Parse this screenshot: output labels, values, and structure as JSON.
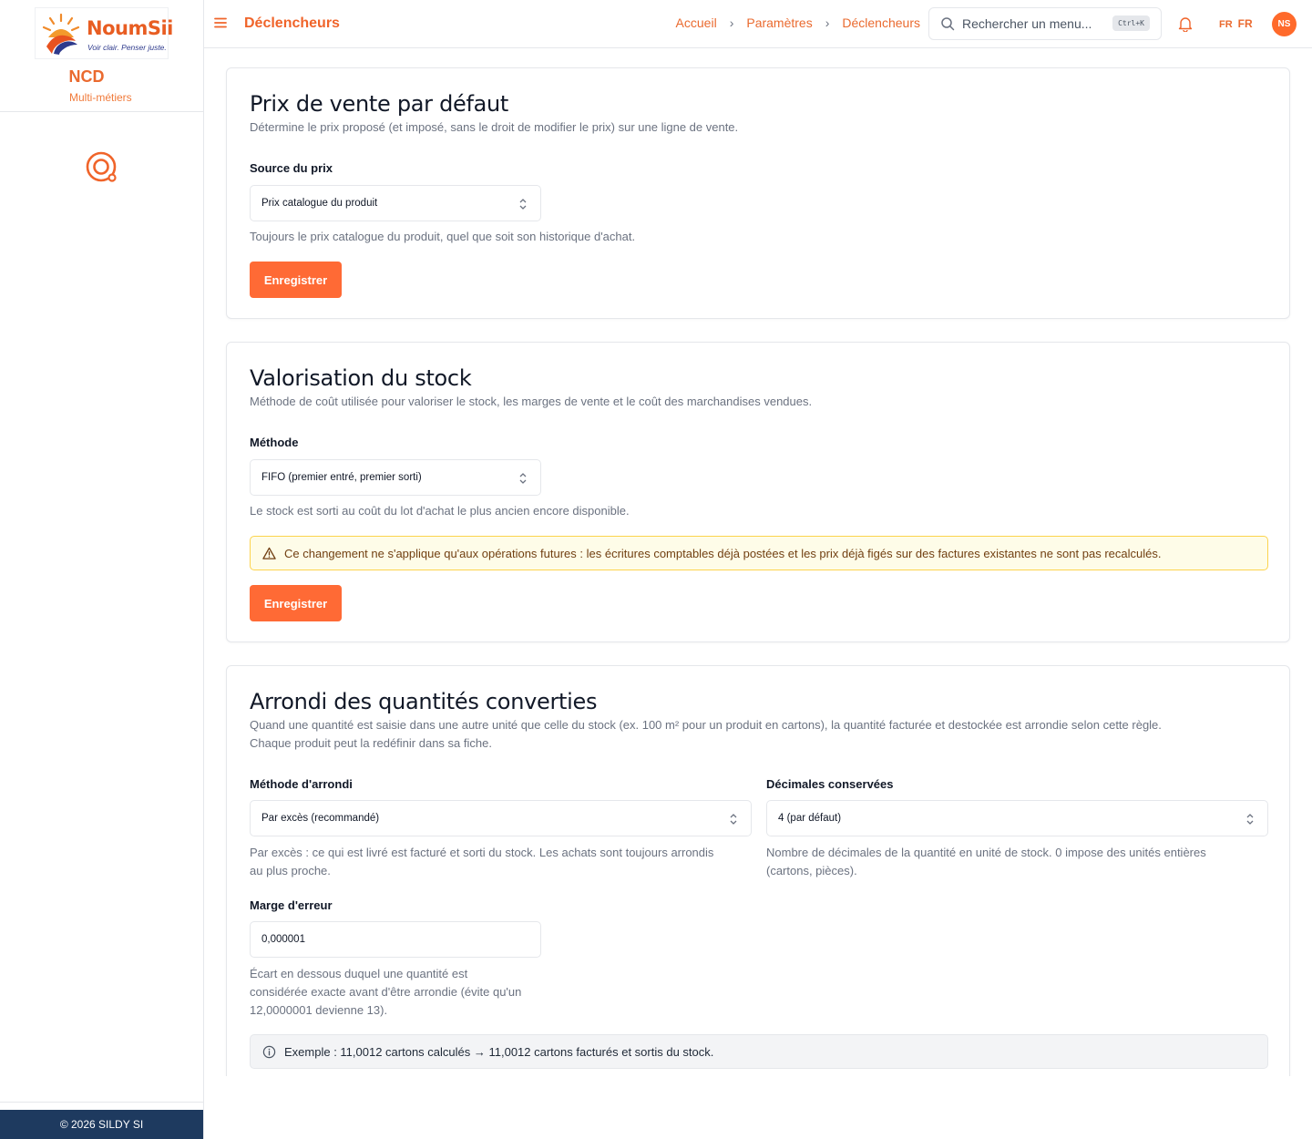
{
  "brand": {
    "logo_name": "NoumSii",
    "logo_tagline": "Voir clair. Penser juste.",
    "org_name": "NCD",
    "org_subtitle": "Multi-métiers",
    "footer": "© 2026 SILDY SI",
    "accent_color": "#ff6a35"
  },
  "header": {
    "title": "Déclencheurs",
    "breadcrumbs": [
      "Accueil",
      "Paramètres",
      "Déclencheurs"
    ],
    "search_placeholder": "Rechercher un menu...",
    "search_shortcut": "Ctrl+K",
    "lang_small": "FR",
    "lang": "FR",
    "avatar_initials": "NS"
  },
  "sections": {
    "prix": {
      "title": "Prix de vente par défaut",
      "description": "Détermine le prix proposé (et imposé, sans le droit de modifier le prix) sur une ligne de vente.",
      "field_label": "Source du prix",
      "field_value": "Prix catalogue du produit",
      "hint": "Toujours le prix catalogue du produit, quel que soit son historique d'achat.",
      "button": "Enregistrer"
    },
    "stock": {
      "title": "Valorisation du stock",
      "description": "Méthode de coût utilisée pour valoriser le stock, les marges de vente et le coût des marchandises vendues.",
      "field_label": "Méthode",
      "field_value": "FIFO (premier entré, premier sorti)",
      "hint": "Le stock est sorti au coût du lot d'achat le plus ancien encore disponible.",
      "warning": "Ce changement ne s'applique qu'aux opérations futures : les écritures comptables déjà postées et les prix déjà figés sur des factures existantes ne sont pas recalculés.",
      "button": "Enregistrer"
    },
    "arrondi": {
      "title": "Arrondi des quantités converties",
      "description_line1": "Quand une quantité est saisie dans une autre unité que celle du stock (ex. 100 m² pour un produit en cartons), la quantité facturée et destockée est arrondie selon cette règle.",
      "description_line2": "Chaque produit peut la redéfinir dans sa fiche.",
      "method_label": "Méthode d'arrondi",
      "method_value": "Par excès (recommandé)",
      "method_hint_line1": "Par excès : ce qui est livré est facturé et sorti du stock. Les achats sont toujours arrondis",
      "method_hint_line2": "au plus proche.",
      "decimals_label": "Décimales conservées",
      "decimals_value": "4 (par défaut)",
      "decimals_hint_line1": "Nombre de décimales de la quantité en unité de stock. 0 impose des unités entières",
      "decimals_hint_line2": "(cartons, pièces).",
      "margin_label": "Marge d'erreur",
      "margin_value": "0,000001",
      "margin_hint_line1": "Écart en dessous duquel une quantité est",
      "margin_hint_line2": "considérée exacte avant d'être arrondie (évite qu'un",
      "margin_hint_line3": "12,0000001 devienne 13).",
      "example": "Exemple : 11,0012 cartons calculés → 11,0012 cartons facturés et sortis du stock."
    }
  },
  "icons": {
    "menu": "hamburger-icon",
    "search": "search-icon",
    "bell": "bell-icon",
    "nav": "target-icon",
    "warning": "warning-triangle-icon",
    "info": "info-circle-icon",
    "select": "chevron-up-down-icon"
  }
}
